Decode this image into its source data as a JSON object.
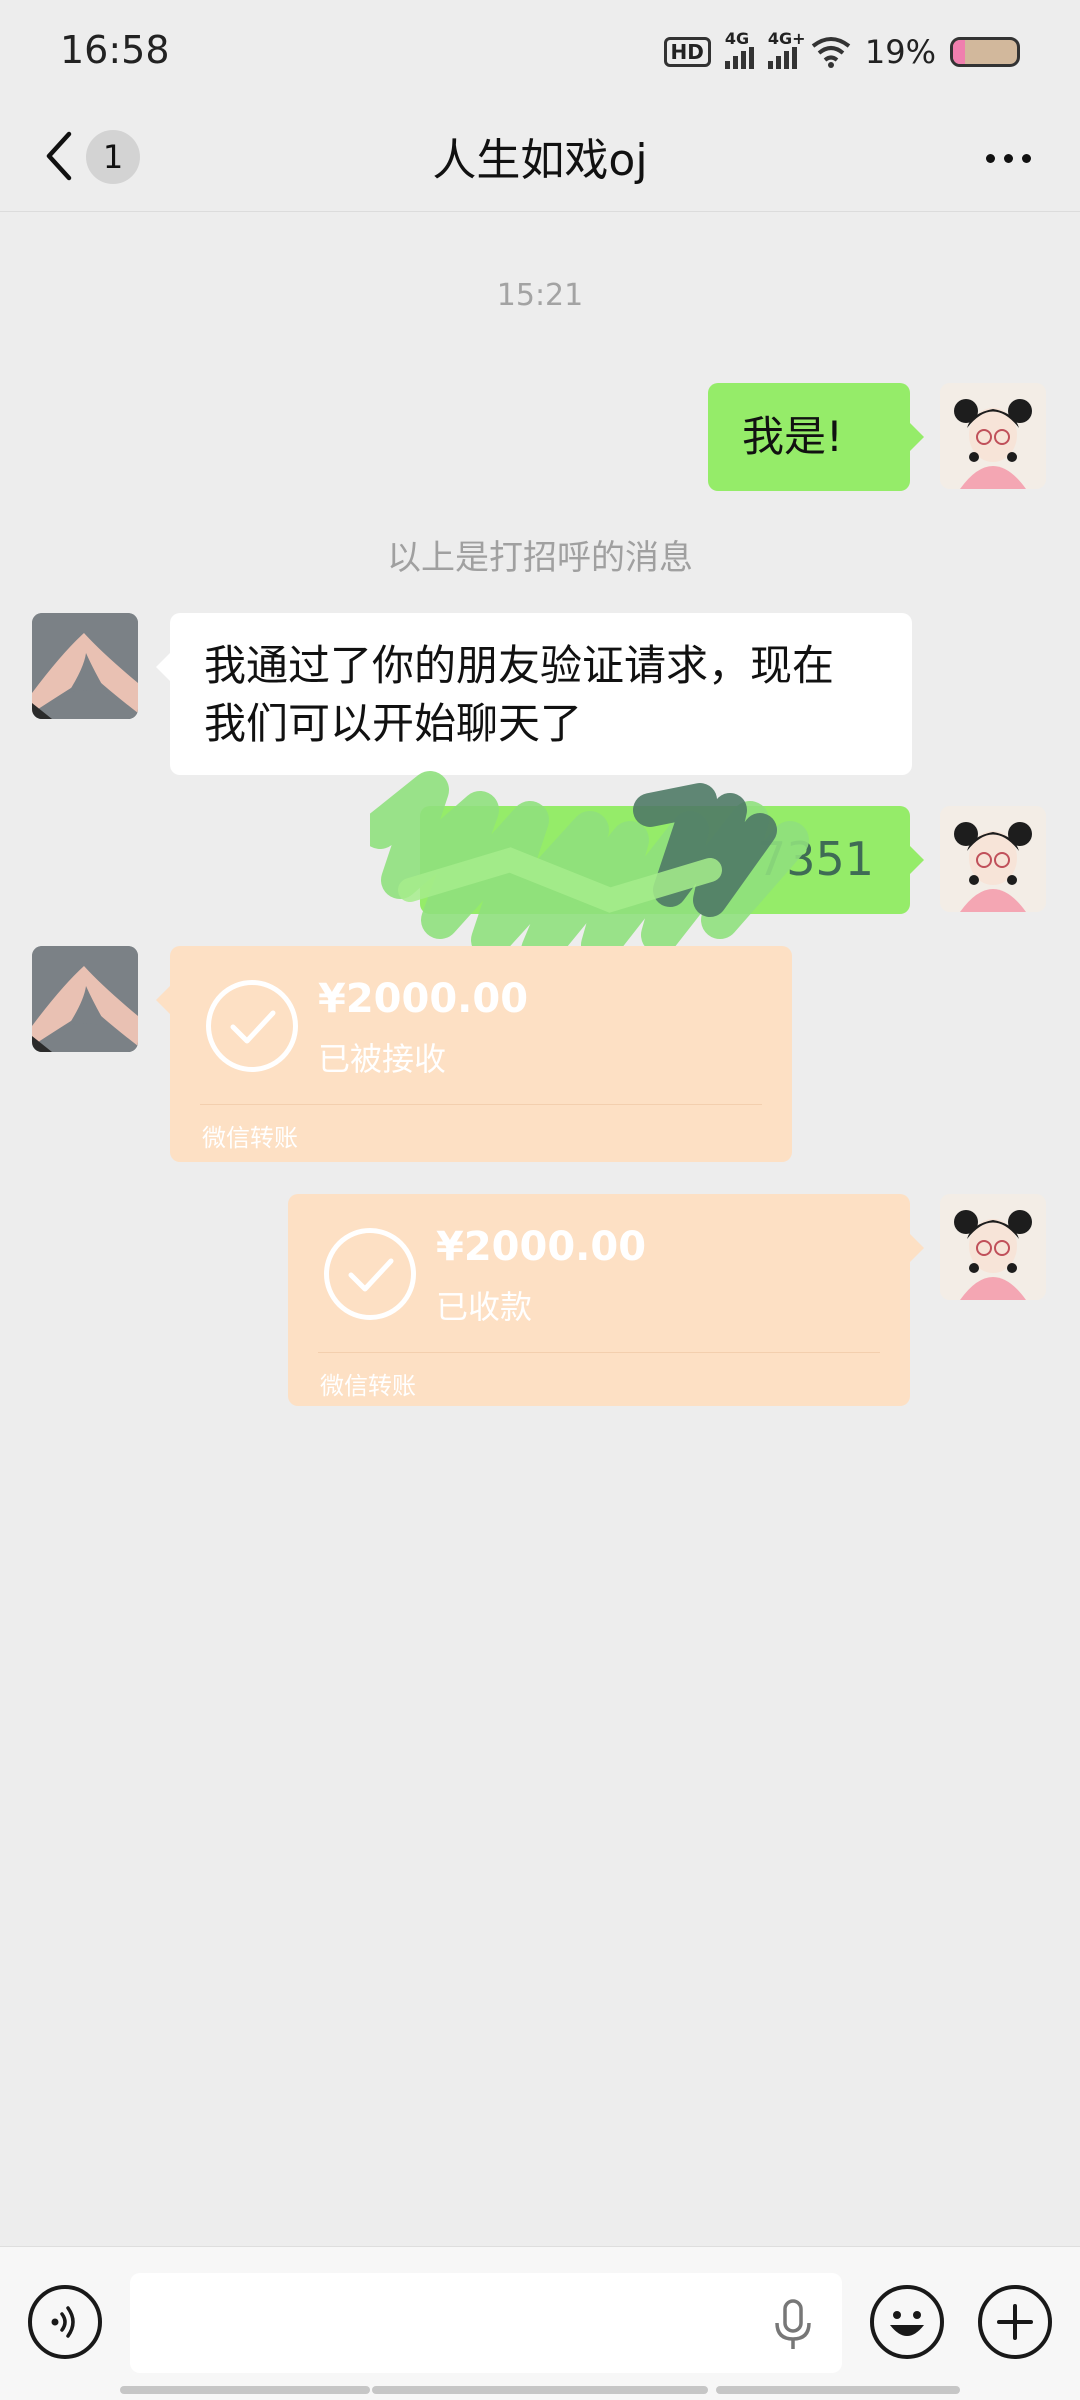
{
  "status_bar": {
    "time": "16:58",
    "hd_label": "HD",
    "signal1_label": "4G",
    "signal2_label": "4G+",
    "battery_percent_text": "19%",
    "battery_level": 0.19
  },
  "nav": {
    "unread_count": "1",
    "title": "人生如戏oj"
  },
  "chat": {
    "timestamp": "15:21",
    "msg1_text": "我是!",
    "system_notice": "以上是打招呼的消息",
    "msg2_line1": "我通过了你的朋友验证请求，现在",
    "msg2_line2": "我们可以开始聊天了",
    "msg3_visible_text": "7351",
    "transfer1": {
      "amount": "¥2000.00",
      "status": "已被接收",
      "footer": "微信转账"
    },
    "transfer2": {
      "amount": "¥2000.00",
      "status": "已收款",
      "footer": "微信转账"
    }
  },
  "input": {
    "placeholder": ""
  },
  "colors": {
    "background": "#ededed",
    "sent_bubble": "#95ec69",
    "received_bubble": "#ffffff",
    "transfer_card": "#fde0c4"
  },
  "icons": {
    "back": "chevron-left-icon",
    "more": "more-dots-icon",
    "voice": "voice-icon",
    "mic": "mic-icon",
    "emoji": "emoji-icon",
    "plus": "plus-icon",
    "check": "check-icon"
  }
}
